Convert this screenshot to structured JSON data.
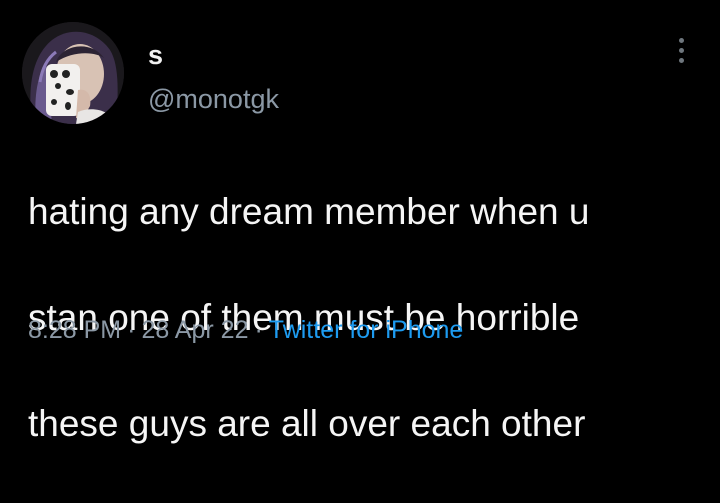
{
  "tweet": {
    "author": {
      "display_name": "s",
      "handle": "@monotgk",
      "avatar": "profile-photo"
    },
    "menu_icon": "more-vertical-icon",
    "text_lines": [
      "hating any dream member when u",
      "stan one of them must be horrible",
      "these guys are all over each other"
    ],
    "meta": {
      "time": "8:28 PM",
      "separator": "·",
      "date": "28 Apr 22",
      "source": "Twitter for iPhone"
    }
  },
  "colors": {
    "background": "#000000",
    "text": "#f5f5f5",
    "secondary": "#8b98a5",
    "link": "#1d9bf0"
  }
}
